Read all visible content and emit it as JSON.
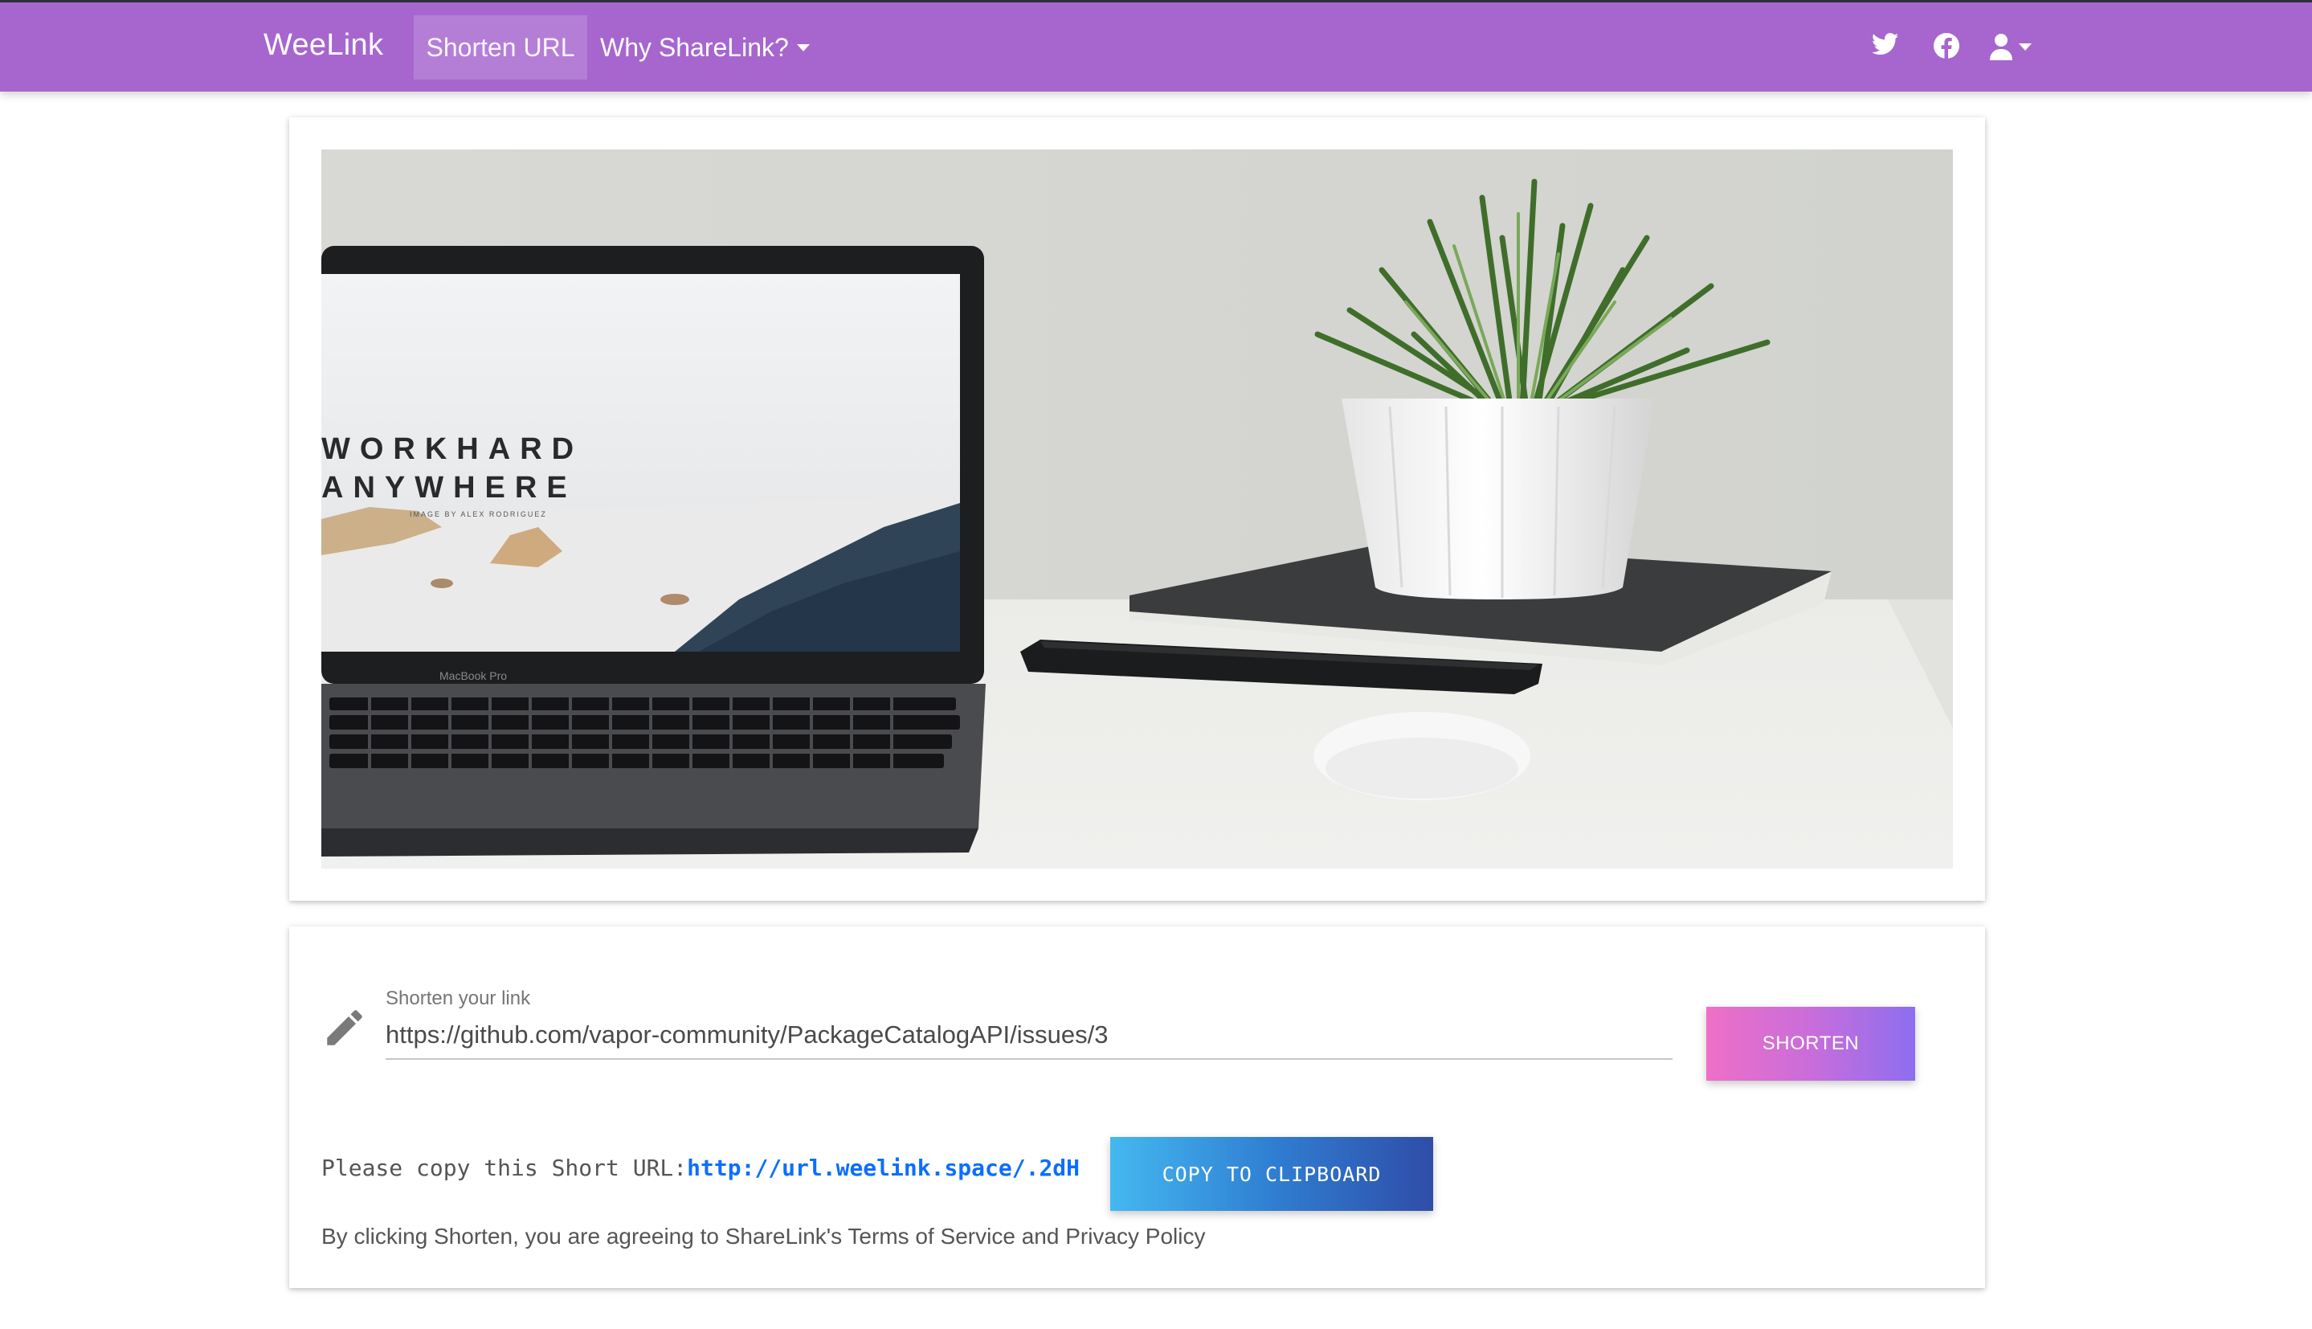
{
  "navbar": {
    "brand": "WeeLink",
    "shorten_url": "Shorten URL",
    "why_sharelink": "Why ShareLink?",
    "icons": [
      "twitter-icon",
      "facebook-icon",
      "user-icon"
    ],
    "background": "#a766ce"
  },
  "hero": {
    "laptop_screen_line1": "WORKHARD",
    "laptop_screen_line2": "ANYWHERE",
    "laptop_screen_credit": "IMAGE BY ALEX RODRIGUEZ",
    "laptop_brand": "MacBook Pro"
  },
  "form": {
    "label": "Shorten your link",
    "input_value": "https://github.com/vapor-community/PackageCatalogAPI/issues/3",
    "shorten_button": "SHORTEN",
    "copy_prompt": "Please copy this Short URL:",
    "short_url": "http://url.weelink.space/.2dH",
    "copy_button": "COPY TO CLIPBOARD",
    "terms": "By clicking Shorten, you are agreeing to ShareLink's Terms of Service and Privacy Policy"
  }
}
